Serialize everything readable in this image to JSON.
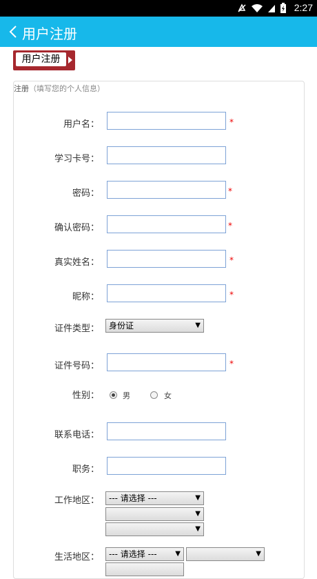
{
  "status_bar": {
    "time": "2:27",
    "icons": [
      "mute-icon",
      "wifi-icon",
      "signal-icon",
      "battery-icon"
    ]
  },
  "app_bar": {
    "title": "用户注册",
    "back_icon": "chevron-left-icon"
  },
  "section_badge": "用户注册",
  "form": {
    "legend": "注册",
    "legend_hint": "（填写您的个人信息）",
    "required_mark": "*",
    "fields": {
      "username": {
        "label": "用户名："
      },
      "card_no": {
        "label": "学习卡号："
      },
      "password": {
        "label": "密码："
      },
      "confirm_password": {
        "label": "确认密码："
      },
      "real_name": {
        "label": "真实姓名："
      },
      "nickname": {
        "label": "昵称："
      },
      "id_type": {
        "label": "证件类型：",
        "selected": "身份证"
      },
      "id_number": {
        "label": "证件号码："
      },
      "gender": {
        "label": "性别：",
        "options": [
          "男",
          "女"
        ],
        "selected": "男"
      },
      "phone": {
        "label": "联系电话："
      },
      "position": {
        "label": "职务："
      },
      "work_region": {
        "label": "工作地区：",
        "selected": [
          "--- 请选择 ---",
          "",
          ""
        ]
      },
      "live_region": {
        "label": "生活地区：",
        "selected": [
          "--- 请选择 ---",
          "",
          ""
        ]
      }
    }
  }
}
